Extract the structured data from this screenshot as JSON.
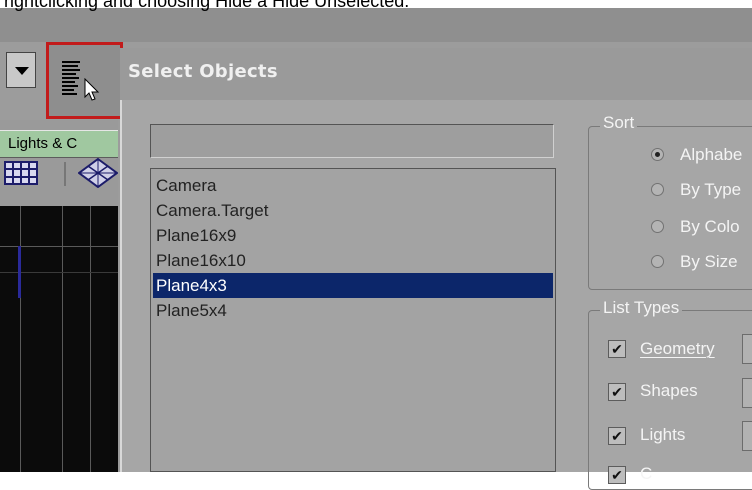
{
  "caption": "rightclicking and choosing Hide a Hide Unselected.",
  "toolbar": {
    "dropdown_icon": "chevron-down-icon",
    "select_by_name_icon": "select-by-name-icon"
  },
  "left_panel": {
    "tab_label": "Lights & C"
  },
  "dialog": {
    "title": "Select Objects",
    "search_value": "",
    "objects": [
      {
        "label": "Camera",
        "selected": false
      },
      {
        "label": "Camera.Target",
        "selected": false
      },
      {
        "label": "Plane16x9",
        "selected": false
      },
      {
        "label": "Plane16x10",
        "selected": false
      },
      {
        "label": "Plane4x3",
        "selected": true
      },
      {
        "label": "Plane5x4",
        "selected": false
      }
    ],
    "sort": {
      "title": "Sort",
      "options": [
        {
          "label": "Alphabe",
          "checked": true
        },
        {
          "label": "By Type",
          "checked": false
        },
        {
          "label": "By Colo",
          "checked": false
        },
        {
          "label": "By Size",
          "checked": false
        }
      ]
    },
    "list_types": {
      "title": "List Types",
      "items": [
        {
          "label": "Geometry",
          "checked": true
        },
        {
          "label": "Shapes",
          "checked": true
        },
        {
          "label": "Lights",
          "checked": true
        },
        {
          "label": "C",
          "checked": true
        }
      ]
    }
  },
  "colors": {
    "selection": "#0c266a",
    "highlight_border": "#c21b1b",
    "tab_green": "#a0c8a0"
  }
}
